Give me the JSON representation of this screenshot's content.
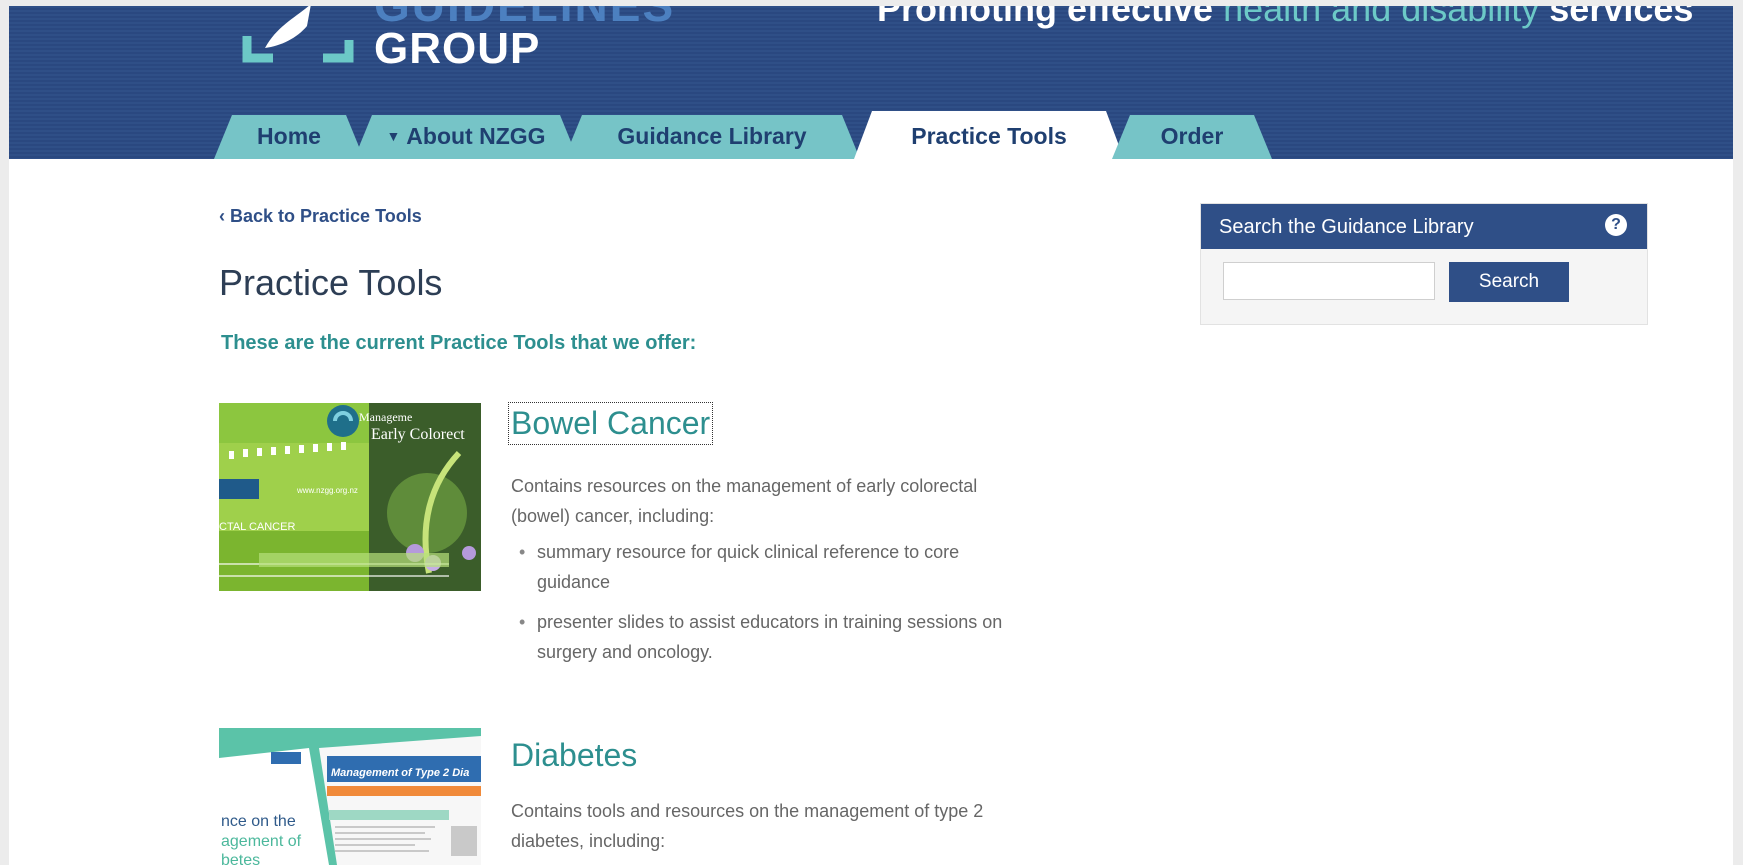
{
  "header": {
    "logo_top_partial": "GUIDELINES",
    "logo_group": "GROUP",
    "tagline_prefix": "Promoting effective ",
    "tagline_highlight": "health and disability",
    "tagline_suffix": " services"
  },
  "nav": {
    "tabs": [
      {
        "label": "Home"
      },
      {
        "label": "About NZGG",
        "has_dropdown": true
      },
      {
        "label": "Guidance Library"
      },
      {
        "label": "Practice Tools",
        "active": true
      },
      {
        "label": "Order"
      }
    ]
  },
  "main": {
    "back_link": "‹ Back to Practice Tools",
    "title": "Practice Tools",
    "intro": "These are the current Practice Tools that we offer:",
    "items": [
      {
        "title": "Bowel Cancer",
        "description": "Contains resources on the management of early colorectal (bowel) cancer, including:",
        "bullets": [
          "summary resource for quick clinical reference to core guidance",
          "presenter slides to assist educators in training sessions on surgery and oncology."
        ],
        "thumb": {
          "line1": "Manageme",
          "line2": "Early Colorect",
          "side": "CTAL CANCER",
          "site": "www.nzgg.org.nz"
        }
      },
      {
        "title": "Diabetes",
        "description": "Contains tools and resources on the management of type 2 diabetes, including:",
        "bullets": [],
        "thumb": {
          "heading": "Management of Type 2 Dia",
          "side1": "nce on the",
          "side2": "agement of",
          "side3": "betes"
        }
      }
    ]
  },
  "search": {
    "heading": "Search the Guidance Library",
    "help_icon": "?",
    "input_value": "",
    "button_label": "Search"
  },
  "colors": {
    "navy": "#2f4f87",
    "teal": "#2d8f8f",
    "tab": "#76c4c7"
  }
}
